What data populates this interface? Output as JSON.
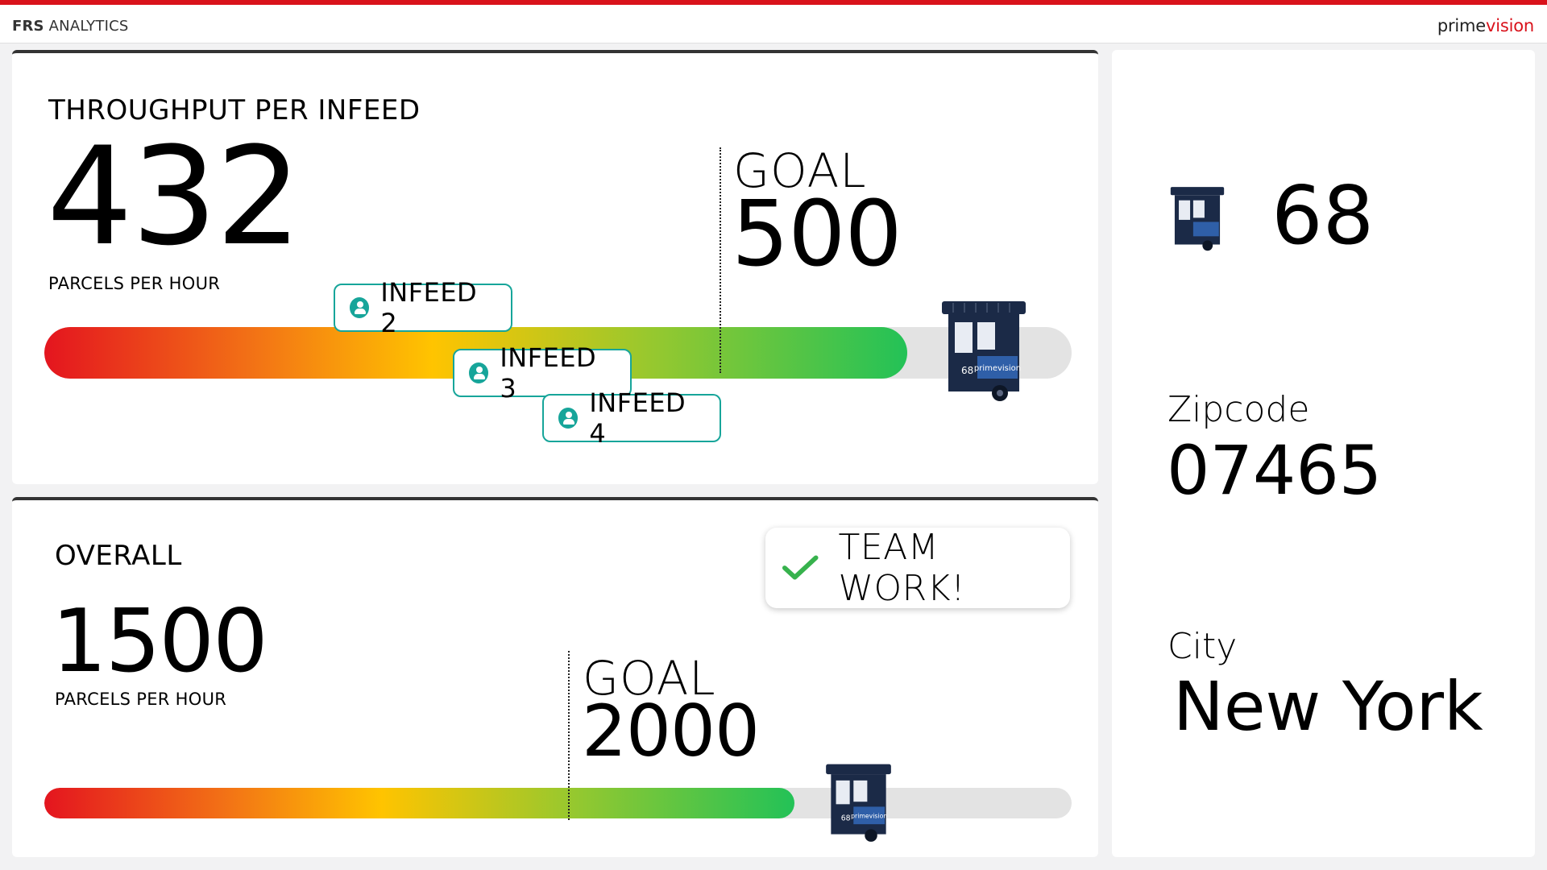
{
  "header": {
    "app_name_bold": "FRS",
    "app_name_rest": "ANALYTICS",
    "brand_a": "prime",
    "brand_b": "vision"
  },
  "throughput": {
    "title": "THROUGHPUT PER INFEED",
    "value": "432",
    "unit": "PARCELS PER HOUR",
    "goal_label": "GOAL",
    "goal_value": "500",
    "progress": 0.84,
    "infeeds": [
      {
        "label": "INFEED 2"
      },
      {
        "label": "INFEED 3"
      },
      {
        "label": "INFEED 4"
      }
    ]
  },
  "overall": {
    "title": "OVERALL",
    "value": "1500",
    "unit": "PARCELS PER HOUR",
    "goal_label": "GOAL",
    "goal_value": "2000",
    "progress": 0.73,
    "badge": "TEAM WORK!"
  },
  "robot": {
    "number": "68",
    "brand": "primevision"
  },
  "info": {
    "robot_number": "68",
    "zipcode_label": "Zipcode",
    "zipcode_value": "07465",
    "city_label": "City",
    "city_value": "New York"
  },
  "colors": {
    "accent_red": "#d9121b",
    "teal": "#17a59a",
    "robot_navy": "#1b2a47",
    "robot_blue": "#2f5fa8"
  }
}
